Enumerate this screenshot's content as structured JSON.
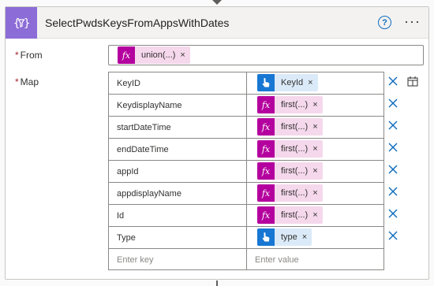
{
  "action": {
    "title": "SelectPwdsKeysFromAppsWithDates",
    "help_icon": "question-icon",
    "more_icon": "ellipsis-icon",
    "op_icon": "select-operation-icon"
  },
  "from": {
    "label": "From",
    "required_mark": "*",
    "token": {
      "type": "expression",
      "label": "union(...)",
      "remove": "×"
    }
  },
  "map": {
    "label": "Map",
    "required_mark": "*",
    "rows": [
      {
        "key": "KeyID",
        "token": {
          "type": "dynamic",
          "label": "KeyId",
          "remove": "×"
        }
      },
      {
        "key": "KeydisplayName",
        "token": {
          "type": "expression",
          "label": "first(...)",
          "remove": "×"
        }
      },
      {
        "key": "startDateTime",
        "token": {
          "type": "expression",
          "label": "first(...)",
          "remove": "×"
        }
      },
      {
        "key": "endDateTime",
        "token": {
          "type": "expression",
          "label": "first(...)",
          "remove": "×"
        }
      },
      {
        "key": "appId",
        "token": {
          "type": "expression",
          "label": "first(...)",
          "remove": "×"
        }
      },
      {
        "key": "appdisplayName",
        "token": {
          "type": "expression",
          "label": "first(...)",
          "remove": "×"
        }
      },
      {
        "key": "Id",
        "token": {
          "type": "expression",
          "label": "first(...)",
          "remove": "×"
        }
      },
      {
        "key": "Type",
        "token": {
          "type": "dynamic",
          "label": "type",
          "remove": "×"
        }
      }
    ],
    "new_row": {
      "key_placeholder": "Enter key",
      "value_placeholder": "Enter value"
    },
    "switch_icon": "switch-to-text-mode-icon",
    "remove_icon": "close-icon"
  },
  "colors": {
    "header_icon": "#8c6cd6",
    "expression_token": "#b4009e",
    "dynamic_token": "#1777d3",
    "accent": "#0f6cbd"
  }
}
